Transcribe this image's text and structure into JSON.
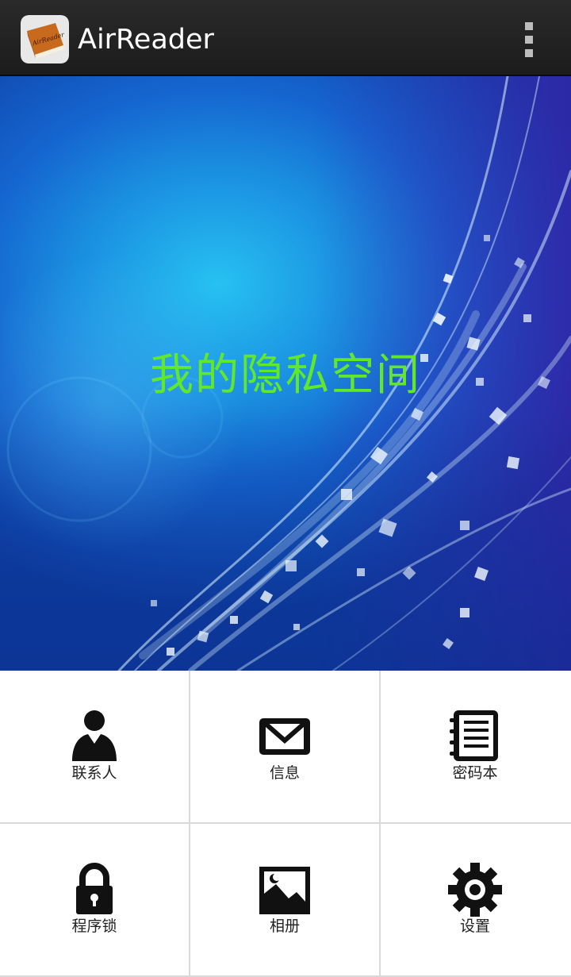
{
  "app_bar": {
    "title": "AirReader",
    "icon": "book-icon",
    "icon_text": "AirReader",
    "overflow_icon": "overflow-menu-icon"
  },
  "banner": {
    "title": "我的隐私空间"
  },
  "grid": {
    "items": [
      {
        "label": "联系人",
        "icon": "contacts-icon"
      },
      {
        "label": "信息",
        "icon": "messages-icon"
      },
      {
        "label": "密码本",
        "icon": "notebook-icon"
      },
      {
        "label": "程序锁",
        "icon": "lock-icon"
      },
      {
        "label": "相册",
        "icon": "gallery-icon"
      },
      {
        "label": "设置",
        "icon": "settings-icon"
      }
    ]
  },
  "colors": {
    "action_bar": "#1f1f1f",
    "banner_title": "#62e82a",
    "grid_divider": "#d9d9d9"
  }
}
